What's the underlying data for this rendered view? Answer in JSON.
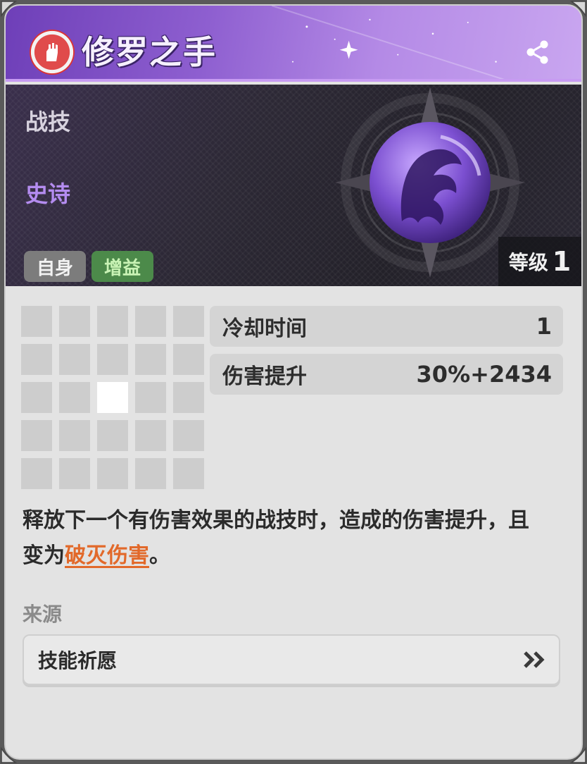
{
  "header": {
    "title": "修罗之手",
    "element_icon": "imaginary-fist-icon",
    "share_icon": "share-icon"
  },
  "banner": {
    "skill_type": "战技",
    "rarity": "史诗",
    "tags": [
      "自身",
      "增益"
    ],
    "level_label": "等级",
    "level_value": "1"
  },
  "range_grid": {
    "rows": 5,
    "cols": 5,
    "active_cells": [
      [
        2,
        2
      ]
    ]
  },
  "stats": [
    {
      "label": "冷却时间",
      "value": "1"
    },
    {
      "label": "伤害提升",
      "value": "30%+2434"
    }
  ],
  "description": {
    "text_before": "释放下一个有伤害效果的战技时，造成的伤害提升，且变为",
    "highlight": "破灭伤害",
    "text_after": "。"
  },
  "source": {
    "label": "来源",
    "item": "技能祈愿",
    "icon": "double-chevron-right-icon"
  },
  "colors": {
    "header_purple": "#8e5fd0",
    "rarity_purple": "#b48cf0",
    "buff_green": "#4c8a4a",
    "highlight_orange": "#e2692a"
  }
}
